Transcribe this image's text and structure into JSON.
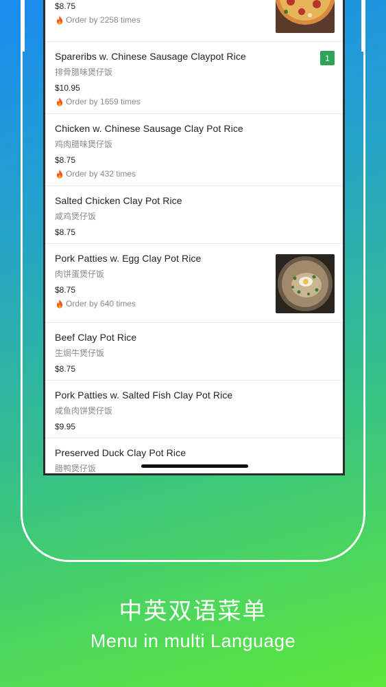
{
  "menu": {
    "items": [
      {
        "price": "$8.75",
        "orders": "Order by 2258 times"
      },
      {
        "name": "Spareribs w. Chinese Sausage Claypot Rice",
        "name_cn": "排骨腊味煲仔饭",
        "price": "$10.95",
        "orders": "Order by 1659 times",
        "qty": "1"
      },
      {
        "name": "Chicken w. Chinese Sausage Clay Pot Rice",
        "name_cn": "鸡肉腊味煲仔饭",
        "price": "$8.75",
        "orders": "Order by 432 times"
      },
      {
        "name": "Salted Chicken Clay Pot Rice",
        "name_cn": "咸鸡煲仔饭",
        "price": "$8.75"
      },
      {
        "name": "Pork Patties w. Egg Clay Pot Rice",
        "name_cn": "肉饼蛋煲仔饭",
        "price": "$8.75",
        "orders": "Order by 640 times"
      },
      {
        "name": "Beef Clay Pot Rice",
        "name_cn": "生焗牛煲仔饭",
        "price": "$8.75"
      },
      {
        "name": "Pork Patties w. Salted Fish Clay Pot Rice",
        "name_cn": "咸鱼肉饼煲仔饭",
        "price": "$9.95"
      },
      {
        "name": "Preserved Duck Clay Pot Rice",
        "name_cn": "腊鸭煲仔饭"
      }
    ]
  },
  "caption": {
    "title_cn": "中英双语菜单",
    "title_en": "Menu in multi Language"
  },
  "colors": {
    "badge": "#2ea457",
    "flame": "#f4511e"
  },
  "icons": {
    "flame": "flame-icon",
    "thumbnail": "food-photo"
  }
}
